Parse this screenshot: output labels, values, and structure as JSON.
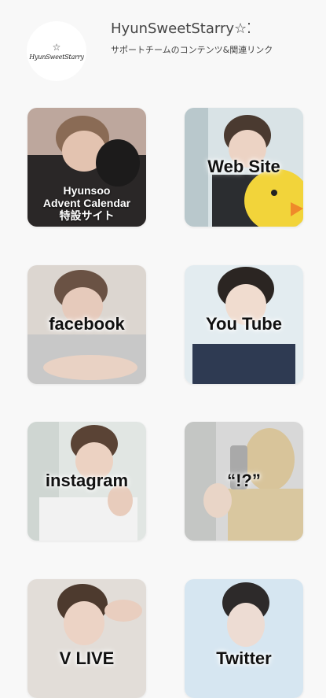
{
  "profile": {
    "name": "HyunSweetStarry☆⁚",
    "description": "サポートチームのコンテンツ&関連リンク",
    "avatar_text": "HyunSweetStarry"
  },
  "links": [
    {
      "line1": "Hyunsoo",
      "line2": "Advent Calendar",
      "line3": "特設サイト"
    },
    {
      "label": "Web Site"
    },
    {
      "label": "facebook"
    },
    {
      "label": "You Tube"
    },
    {
      "label": "instagram"
    },
    {
      "label": "“!?”"
    },
    {
      "label": "V LIVE"
    },
    {
      "label": "Twitter"
    }
  ],
  "colors": {
    "background": "#f8f8f8",
    "tile_dark": "#2e2b2b",
    "accent_yellow": "#f2d43a"
  }
}
